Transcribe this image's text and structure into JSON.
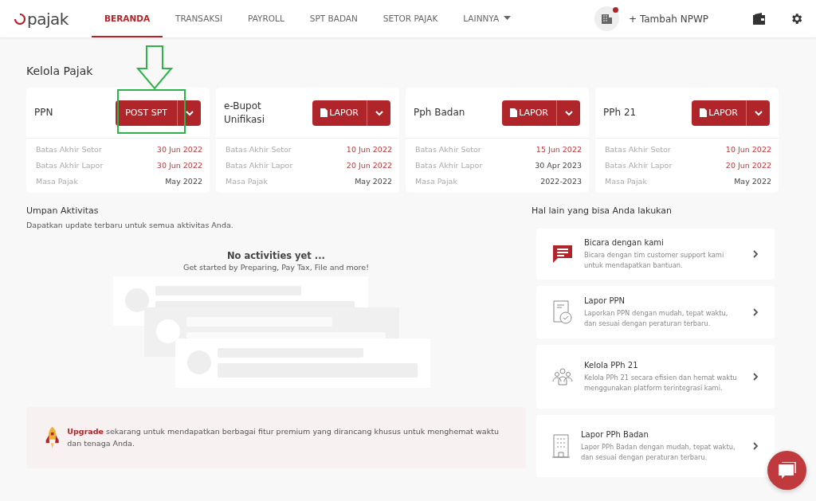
{
  "header": {
    "logo": "pajak",
    "nav": [
      {
        "label": "BERANDA",
        "selected": true,
        "dropdown": false
      },
      {
        "label": "TRANSAKSI",
        "selected": false,
        "dropdown": false
      },
      {
        "label": "PAYROLL",
        "selected": false,
        "dropdown": false
      },
      {
        "label": "SPT BADAN",
        "selected": false,
        "dropdown": false
      },
      {
        "label": "SETOR PAJAK",
        "selected": false,
        "dropdown": false
      },
      {
        "label": "LAINNYA",
        "selected": false,
        "dropdown": true
      }
    ],
    "notification": true,
    "add_npwp": "+ Tambah NPWP"
  },
  "kelola_pajak": {
    "title": "Kelola Pajak",
    "cards": [
      {
        "name": "PPN",
        "button": {
          "kind": "plain",
          "label": "POST SPT"
        },
        "highlighted": true,
        "rows": [
          {
            "label": "Batas Akhir Setor",
            "value": "30 Jun 2022",
            "alert": true
          },
          {
            "label": "Batas Akhir Lapor",
            "value": "30 Jun 2022",
            "alert": true
          },
          {
            "label": "Masa Pajak",
            "value": "May 2022",
            "alert": false
          }
        ]
      },
      {
        "name": "e-Bupot Unifikasi",
        "button": {
          "kind": "document",
          "label": "LAPOR"
        },
        "highlighted": false,
        "rows": [
          {
            "label": "Batas Akhir Setor",
            "value": "10 Jun 2022",
            "alert": true
          },
          {
            "label": "Batas Akhir Lapor",
            "value": "20 Jun 2022",
            "alert": true
          },
          {
            "label": "Masa Pajak",
            "value": "May 2022",
            "alert": false
          }
        ]
      },
      {
        "name": "Pph Badan",
        "button": {
          "kind": "document",
          "label": "LAPOR"
        },
        "highlighted": false,
        "rows": [
          {
            "label": "Batas Akhir Setor",
            "value": "15 Jun 2022",
            "alert": true
          },
          {
            "label": "Batas Akhir Lapor",
            "value": "30 Apr 2023",
            "alert": false
          },
          {
            "label": "Masa Pajak",
            "value": "2022-2023",
            "alert": false
          }
        ]
      },
      {
        "name": "PPh 21",
        "button": {
          "kind": "document",
          "label": "LAPOR"
        },
        "highlighted": false,
        "rows": [
          {
            "label": "Batas Akhir Setor",
            "value": "10 Jun 2022",
            "alert": true
          },
          {
            "label": "Batas Akhir Lapor",
            "value": "20 Jun 2022",
            "alert": true
          },
          {
            "label": "Masa Pajak",
            "value": "May 2022",
            "alert": false
          }
        ]
      }
    ]
  },
  "activity": {
    "title": "Umpan Aktivitas",
    "subtitle": "Dapatkan update terbaru untuk semua aktivitas Anda.",
    "empty_title": "No activities yet ...",
    "empty_text": "Get started by Preparing, Pay Tax, File and more!"
  },
  "upgrade": {
    "text": "**Upgrade** sekarang untuk mendapatkan berbagai fitur premium yang dirancang khusus untuk menghemat waktu dan tenaga Anda."
  },
  "more": {
    "title": "Hal lain yang bisa Anda lakukan",
    "items": [
      {
        "kind": "chat",
        "title": "Bicara dengan kami",
        "text": "Bicara dengan tim customer support kami untuk mendapatkan bantuan."
      },
      {
        "kind": "document",
        "title": "Lapor PPN",
        "text": "Laporkan PPN dengan mudah, tepat waktu, dan sesuai dengan peraturan terbaru."
      },
      {
        "kind": "people",
        "title": "Kelola PPh 21",
        "text": "Kelola PPh 21 secara efisien dan hemat waktu menggunakan platform terintegrasi kami."
      },
      {
        "kind": "building",
        "title": "Lapor PPh Badan",
        "text": "Lapor PPh Badan dengan mudah, tepat waktu, dan sesuai dengan peraturan terbaru."
      }
    ]
  }
}
